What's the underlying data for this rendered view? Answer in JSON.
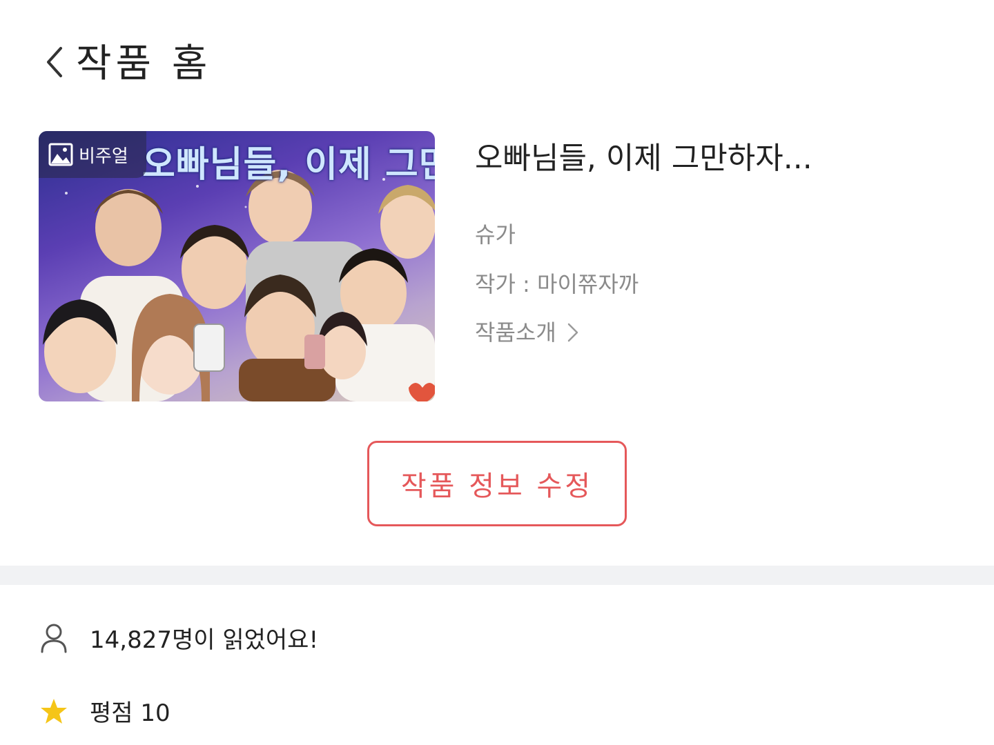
{
  "header": {
    "title": "작품 홈",
    "back_icon": "chevron-left-icon"
  },
  "cover": {
    "badge_label": "비주얼",
    "badge_icon": "image-icon",
    "title_text": "오빠님들, 이제 그만하자..."
  },
  "work": {
    "title": "오빠님들, 이제 그만하자...",
    "character": "슈가",
    "author": "작가 : 마이쮸자까",
    "intro_label": "작품소개",
    "intro_icon": "chevron-right-icon"
  },
  "edit_button": {
    "label": "작품 정보 수정",
    "color": "#e5585a"
  },
  "stats": {
    "readers": "14,827명이 읽었어요!",
    "readers_icon": "user-icon",
    "rating": "평점 10",
    "rating_icon": "star-icon",
    "star_color": "#f5c518"
  }
}
